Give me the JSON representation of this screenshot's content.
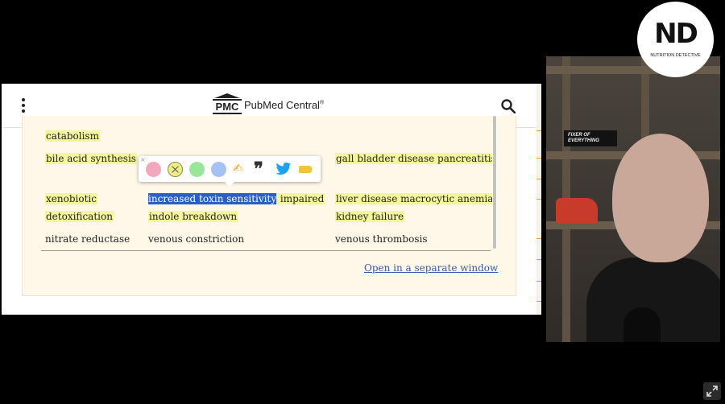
{
  "site": {
    "logo_mark": "PMC",
    "logo_text": "PubMed Central",
    "logo_trademark": "®"
  },
  "table": {
    "rows": [
      {
        "col1": "catabolism",
        "col2": "",
        "col3": ""
      },
      {
        "col1": "bile acid synthesis",
        "col2": "",
        "col3": "gall bladder disease pancreatitis"
      },
      {
        "col1": "xenobiotic",
        "col1b": "detoxification",
        "col2_selected": "increased toxin sensitivity",
        "col2_rest": " impaired",
        "col2b": "indole breakdown",
        "col3": "liver disease macrocytic anemia",
        "col3b": "kidney failure"
      },
      {
        "col1": "nitrate reductase",
        "col2": "venous constriction",
        "col3": "venous thrombosis"
      }
    ]
  },
  "link_text": "Open in a separate window",
  "popover": {
    "close": "×",
    "quote": "❞",
    "hand": "✍"
  },
  "webcam": {
    "sign_text_1": "FIXER OF",
    "sign_text_2": "EVERYTHING",
    "logo_letters": "ND",
    "logo_sub": "NUTRITION DETECTIVE"
  },
  "colors": {
    "highlight": "#f5f59a",
    "selection": "#2a5fc8",
    "link": "#3b58a8",
    "card_bg": "#fff8e9"
  }
}
